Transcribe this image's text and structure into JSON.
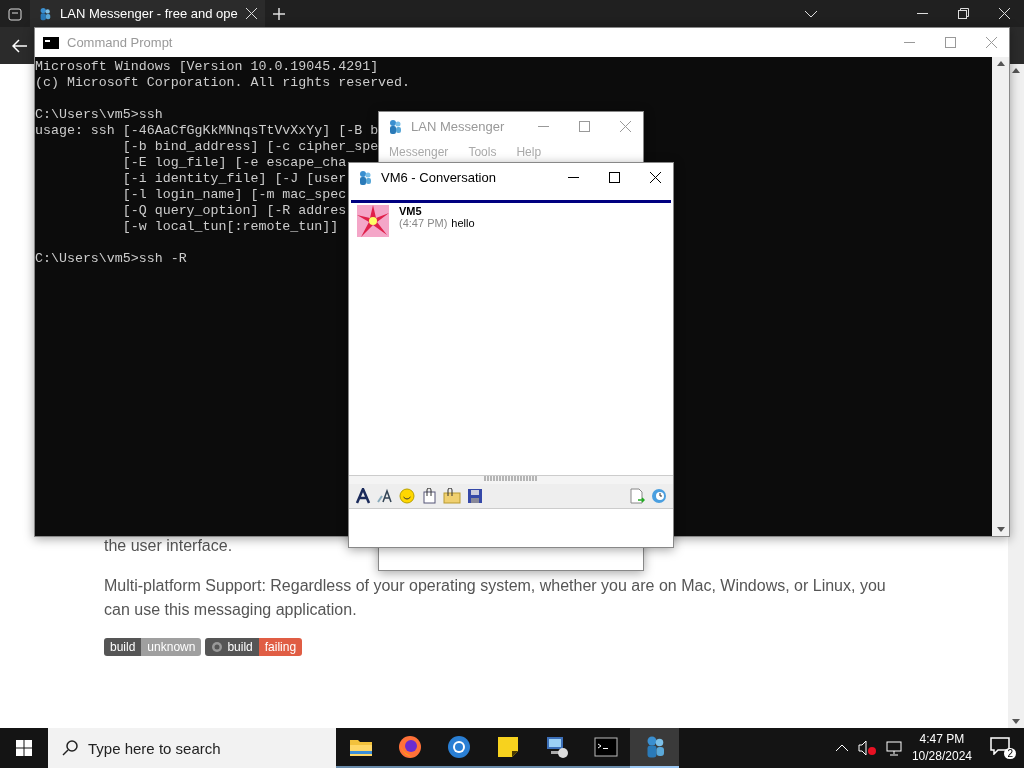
{
  "browser": {
    "tab": {
      "title": "LAN Messenger - free and ope"
    },
    "page": {
      "cut_line": "the user interface.",
      "paragraph": "Multi-platform Support: Regardless of your operating system, whether you are on Mac, Windows, or Linux, you can use this messaging application.",
      "badges": [
        {
          "kind": "plain",
          "label": "build",
          "value": "unknown",
          "color": "#9f9f9f"
        },
        {
          "kind": "icon",
          "label": "build",
          "value": "failing",
          "color": "#e05d44"
        }
      ]
    }
  },
  "command_prompt": {
    "title": "Command Prompt",
    "blocks": [
      [
        "Microsoft Windows [Version 10.0.19045.4291]",
        "(c) Microsoft Corporation. All rights reserved."
      ],
      [
        "C:\\Users\\vm5>ssh",
        "usage: ssh [-46AaCfGgKkMNnqsTtVvXxYy] [-B b",
        "           [-b bind_address] [-c cipher_spe",
        "           [-E log_file] [-e escape_cha",
        "           [-i identity_file] [-J [user",
        "           [-l login_name] [-m mac_spec",
        "           [-Q query_option] [-R addres",
        "           [-w local_tun[:remote_tun]]"
      ],
      [
        "C:\\Users\\vm5>ssh -R"
      ]
    ]
  },
  "lan_messenger": {
    "title": "LAN Messenger",
    "menu": [
      "Messenger",
      "Tools",
      "Help"
    ]
  },
  "conversation": {
    "title": "VM6 - Conversation",
    "messages": [
      {
        "sender": "VM5",
        "time": "(4:47 PM)",
        "text": "hello"
      }
    ]
  },
  "taskbar": {
    "search_placeholder": "Type here to search",
    "apps": [
      {
        "kind": "folder",
        "selected": false
      },
      {
        "kind": "fox",
        "selected": false
      },
      {
        "kind": "ring",
        "selected": false
      },
      {
        "kind": "note",
        "selected": false
      },
      {
        "kind": "computer",
        "selected": false
      },
      {
        "kind": "terminal",
        "selected": false
      },
      {
        "kind": "messenger",
        "selected": true
      }
    ],
    "time": "4:47 PM",
    "date": "10/28/2024",
    "notifications": "2"
  }
}
